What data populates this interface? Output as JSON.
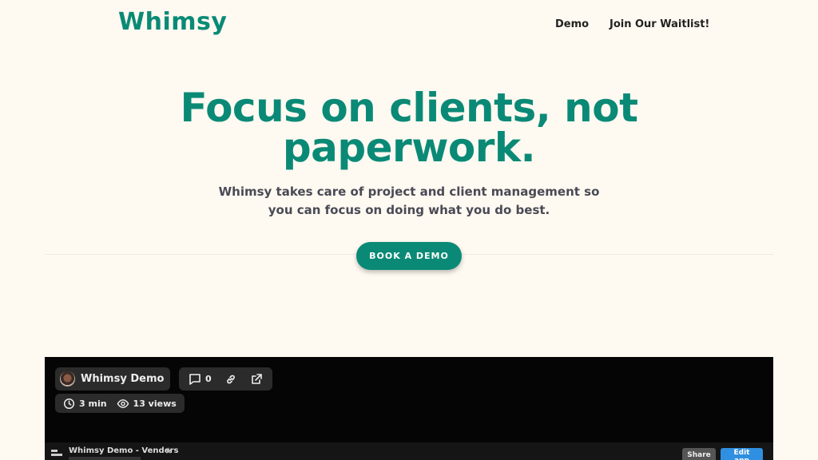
{
  "header": {
    "logo": "Whimsy",
    "nav": [
      {
        "label": "Demo"
      },
      {
        "label": "Join Our Waitlist!"
      }
    ]
  },
  "hero": {
    "headline_line1": "Focus on clients, not",
    "headline_line2": "paperwork.",
    "subtitle_line1": "Whimsy takes care of project and client management so",
    "subtitle_line2": "you can focus on doing what you do best.",
    "cta_label": "BOOK A DEMO"
  },
  "video": {
    "title": "Whimsy Demo",
    "comment_count": "0",
    "duration": "3 min",
    "views": "13 views",
    "icons": {
      "comment": "comment-icon",
      "link": "link-icon",
      "external": "external-link-icon",
      "clock": "clock-icon",
      "eye": "eye-icon"
    },
    "app": {
      "title": "Whimsy Demo - Vendors",
      "share_label": "Share",
      "edit_label": "Edit app"
    }
  },
  "colors": {
    "brand": "#0a8a76",
    "background": "#fef9f1",
    "edit_button": "#2f8fe0"
  }
}
